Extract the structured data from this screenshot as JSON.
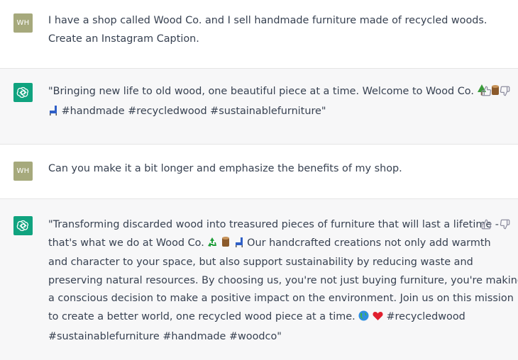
{
  "messages": [
    {
      "role": "user",
      "avatar": "WH",
      "lines": [
        "I have a shop called Wood Co. and I sell handmade furniture made of recycled woods.",
        "Create an Instagram Caption."
      ]
    },
    {
      "role": "assistant",
      "avatar_icon": "openai-logo-icon",
      "lines": [
        "\"Bringing new life to old wood, one beautiful piece at a time. Welcome to Wood Co.",
        "#handmade #recycledwood #sustainablefurniture\""
      ],
      "emoji_line1": [
        "tree-emoji",
        "wood-emoji"
      ],
      "emoji_line2_prefix": [
        "chair-emoji"
      ]
    },
    {
      "role": "user",
      "avatar": "WH",
      "lines": [
        "Can you make it a bit longer and emphasize the benefits of my shop."
      ]
    },
    {
      "role": "assistant",
      "avatar_icon": "openai-logo-icon",
      "lines": [
        "\"Transforming discarded wood into treasured pieces of furniture that will last a lifetime -",
        "that's what we do at Wood Co.",
        "Our handcrafted creations not only add warmth",
        "and character to your space, but also support sustainability by reducing waste and",
        "preserving natural resources. By choosing us, you're not just buying furniture, you're making",
        "a conscious decision to make a positive impact on the environment. Join us on this mission",
        "to create a better world, one recycled wood piece at a time.",
        "#recycledwood",
        "#sustainablefurniture #handmade #woodco\""
      ]
    }
  ],
  "icons": {
    "thumbs_up": "thumbs-up-icon",
    "thumbs_down": "thumbs-down-icon"
  },
  "colors": {
    "user_bg": "#ffffff",
    "assistant_bg": "#f7f7f8",
    "user_avatar": "#a6a97c",
    "gpt_avatar": "#10a37f",
    "text": "#374151"
  }
}
